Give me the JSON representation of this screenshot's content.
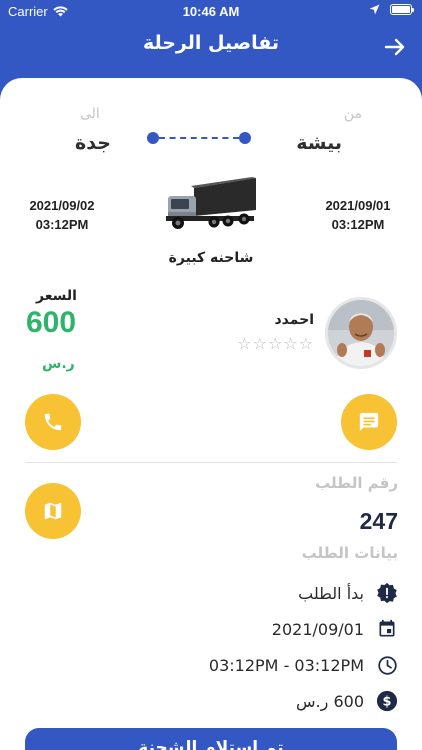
{
  "status_bar": {
    "carrier": "Carrier",
    "time": "10:46 AM"
  },
  "header": {
    "title": "تفاصيل الرحلة",
    "back_icon": "arrow-right-icon"
  },
  "route": {
    "from_label": "من",
    "from_city": "بيشة",
    "to_label": "الى",
    "to_city": "جدة"
  },
  "trip": {
    "start_date": "2021/09/01",
    "start_time": "03:12PM",
    "end_date": "2021/09/02",
    "end_time": "03:12PM",
    "vehicle": "شاحنه كبيرة"
  },
  "driver": {
    "name": "احمدد",
    "rating": 0,
    "max_rating": 5,
    "stars": "☆☆☆☆☆"
  },
  "price": {
    "label": "السعر",
    "value": "600",
    "currency": "ر.س"
  },
  "order": {
    "number_label": "رقم الطلب",
    "number": "247",
    "details_label": "بيانات الطلب",
    "status": "بدأ الطلب",
    "date": "2021/09/01",
    "time_range": "03:12PM - 03:12PM",
    "price": "600 ر.س"
  },
  "bottom_button": {
    "label": "تم استلام الشحنة"
  },
  "colors": {
    "primary": "#3358c4",
    "accent": "#f7c233",
    "price_green": "#2db36a"
  }
}
